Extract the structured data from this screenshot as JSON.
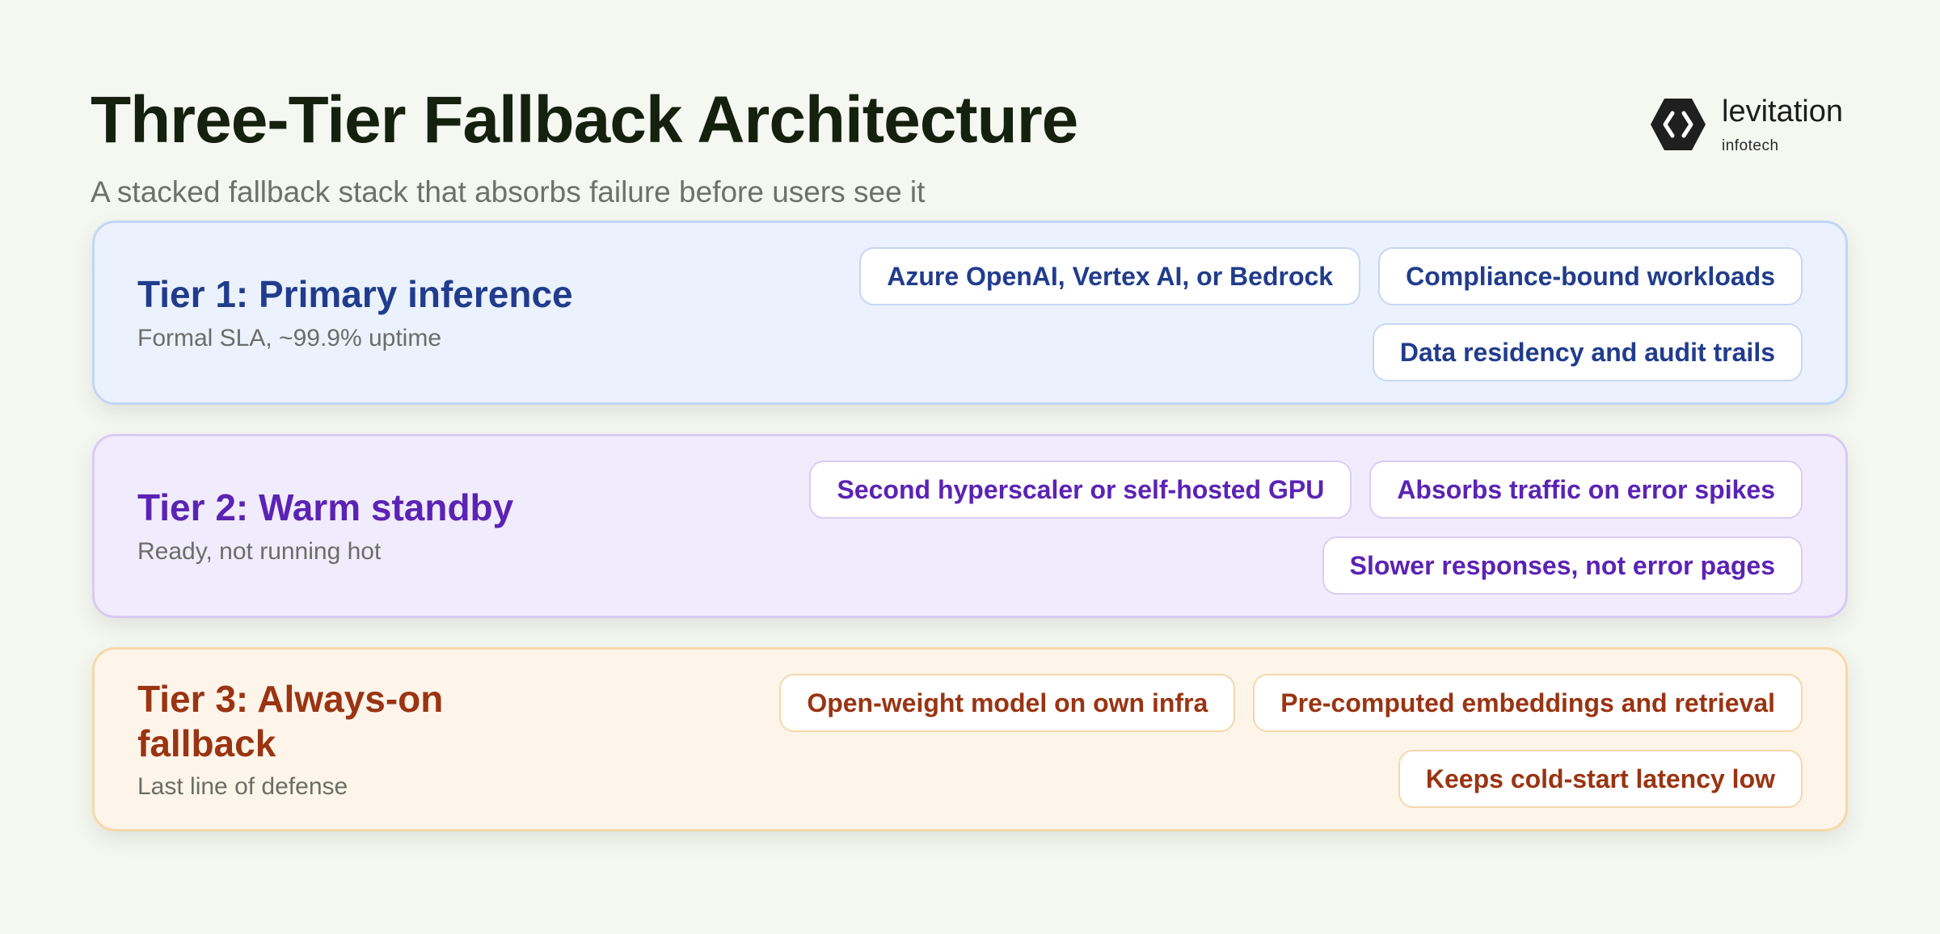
{
  "header": {
    "title": "Three-Tier Fallback Architecture",
    "subtitle": "A stacked fallback stack that absorbs failure before users see it"
  },
  "logo": {
    "name": "levitation",
    "sub": "infotech",
    "icon": "hexagon-code-brackets-icon"
  },
  "tiers": [
    {
      "title": "Tier 1: Primary inference",
      "subtitle": "Formal SLA, ~99.9% uptime",
      "chips": [
        "Azure OpenAI, Vertex AI, or Bedrock",
        "Compliance-bound workloads",
        "Data residency and audit trails"
      ]
    },
    {
      "title": "Tier 2: Warm standby",
      "subtitle": "Ready, not running hot",
      "chips": [
        "Second hyperscaler or self-hosted GPU",
        "Absorbs traffic on error spikes",
        "Slower responses, not error pages"
      ]
    },
    {
      "title": "Tier 3: Always-on fallback",
      "subtitle": "Last line of defense",
      "chips": [
        "Open-weight model on own infra",
        "Pre-computed embeddings and retrieval",
        "Keeps cold-start latency low"
      ]
    }
  ],
  "colors": {
    "background": "#f5f7f1",
    "tier1_accent": "#213c8c",
    "tier2_accent": "#5b23b4",
    "tier3_accent": "#9a3412"
  }
}
